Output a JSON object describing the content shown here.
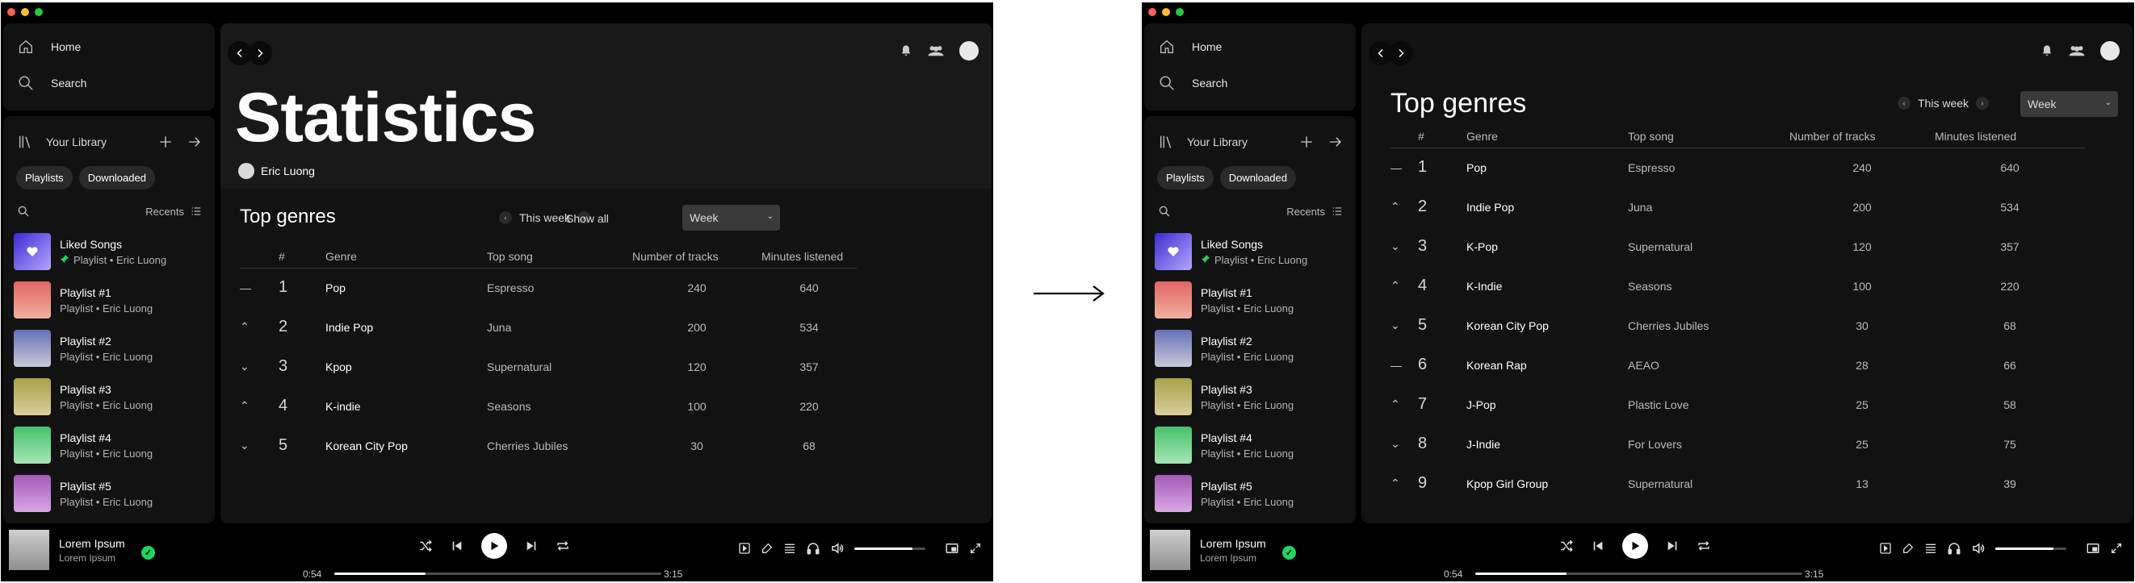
{
  "colors": {
    "background": "#000000",
    "panel": "#121212",
    "accent_green": "#1ed760"
  },
  "nav": {
    "home": "Home",
    "search": "Search"
  },
  "library": {
    "title": "Your Library",
    "chips": [
      "Playlists",
      "Downloaded"
    ],
    "recents": "Recents",
    "items": [
      {
        "name": "Liked Songs",
        "sub": "Playlist • Eric Luong",
        "pinned": true,
        "cover": "liked"
      },
      {
        "name": "Playlist #1",
        "sub": "Playlist • Eric Luong",
        "cover": "red"
      },
      {
        "name": "Playlist #2",
        "sub": "Playlist • Eric Luong",
        "cover": "blue"
      },
      {
        "name": "Playlist #3",
        "sub": "Playlist • Eric Luong",
        "cover": "olive"
      },
      {
        "name": "Playlist #4",
        "sub": "Playlist • Eric Luong",
        "cover": "green"
      },
      {
        "name": "Playlist #5",
        "sub": "Playlist • Eric Luong",
        "cover": "purple"
      }
    ]
  },
  "left": {
    "title": "Statistics",
    "owner": "Eric Luong",
    "section_title": "Top genres",
    "week": "This week",
    "show_all": "Show all",
    "period": "Week",
    "columns": [
      "#",
      "Genre",
      "Top song",
      "Number of tracks",
      "Minutes listened"
    ],
    "rows": [
      {
        "trend": "same",
        "rank": "1",
        "genre": "Pop",
        "song": "Espresso",
        "tracks": "240",
        "minutes": "640"
      },
      {
        "trend": "up",
        "rank": "2",
        "genre": "Indie Pop",
        "song": "Juna",
        "tracks": "200",
        "minutes": "534"
      },
      {
        "trend": "down",
        "rank": "3",
        "genre": "Kpop",
        "song": "Supernatural",
        "tracks": "120",
        "minutes": "357"
      },
      {
        "trend": "up",
        "rank": "4",
        "genre": "K-indie",
        "song": "Seasons",
        "tracks": "100",
        "minutes": "220"
      },
      {
        "trend": "down",
        "rank": "5",
        "genre": "Korean City Pop",
        "song": "Cherries Jubiles",
        "tracks": "30",
        "minutes": "68"
      }
    ]
  },
  "right": {
    "section_title": "Top genres",
    "week": "This week",
    "period": "Week",
    "columns": [
      "#",
      "Genre",
      "Top song",
      "Number of tracks",
      "Minutes listened"
    ],
    "rows": [
      {
        "trend": "same",
        "rank": "1",
        "genre": "Pop",
        "song": "Espresso",
        "tracks": "240",
        "minutes": "640"
      },
      {
        "trend": "up",
        "rank": "2",
        "genre": "Indie Pop",
        "song": "Juna",
        "tracks": "200",
        "minutes": "534"
      },
      {
        "trend": "down",
        "rank": "3",
        "genre": "K-Pop",
        "song": "Supernatural",
        "tracks": "120",
        "minutes": "357"
      },
      {
        "trend": "up",
        "rank": "4",
        "genre": "K-Indie",
        "song": "Seasons",
        "tracks": "100",
        "minutes": "220"
      },
      {
        "trend": "down",
        "rank": "5",
        "genre": "Korean City Pop",
        "song": "Cherries Jubiles",
        "tracks": "30",
        "minutes": "68"
      },
      {
        "trend": "same",
        "rank": "6",
        "genre": "Korean Rap",
        "song": "AEAO",
        "tracks": "28",
        "minutes": "66"
      },
      {
        "trend": "up",
        "rank": "7",
        "genre": "J-Pop",
        "song": "Plastic Love",
        "tracks": "25",
        "minutes": "58"
      },
      {
        "trend": "down",
        "rank": "8",
        "genre": "J-Indie",
        "song": "For Lovers",
        "tracks": "25",
        "minutes": "75"
      },
      {
        "trend": "up",
        "rank": "9",
        "genre": "Kpop Girl Group",
        "song": "Supernatural",
        "tracks": "13",
        "minutes": "39"
      }
    ]
  },
  "player": {
    "title": "Lorem Ipsum",
    "artist": "Lorem Ipsum",
    "elapsed": "0:54",
    "duration": "3:15",
    "progress": 0.28,
    "volume": 0.82
  }
}
